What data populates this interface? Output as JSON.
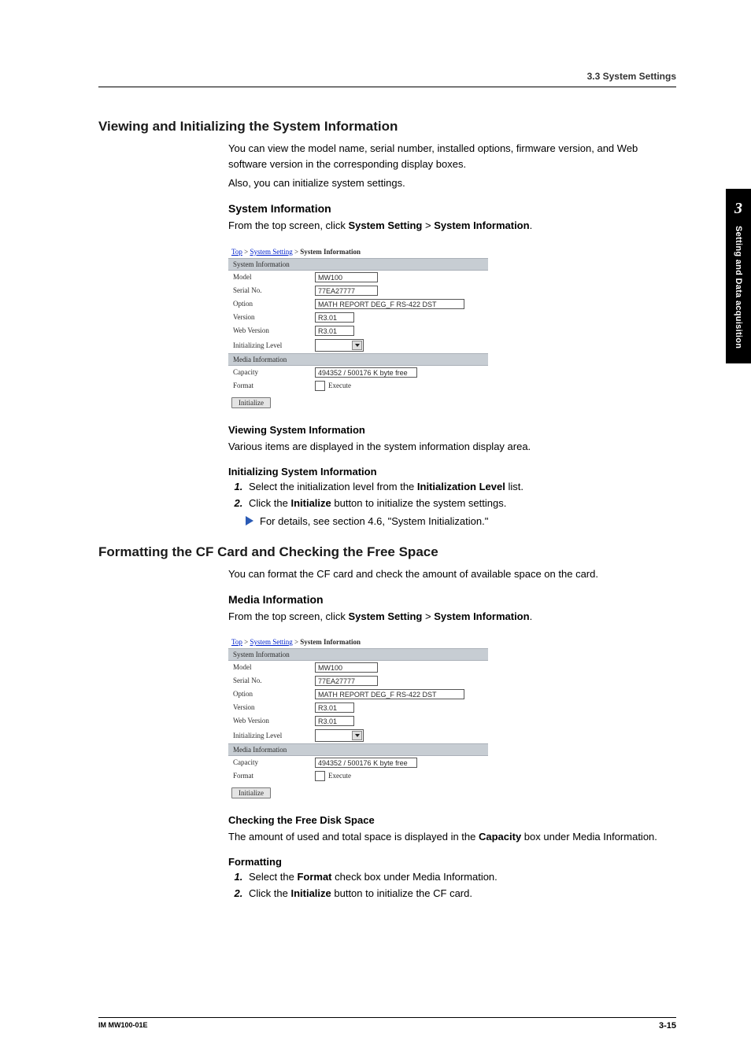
{
  "header": {
    "section": "3.3  System Settings"
  },
  "sideTab": {
    "chapter": "3",
    "label": "Setting and Data acquisition"
  },
  "footer": {
    "doc": "IM MW100-01E",
    "page": "3-15"
  },
  "sec1": {
    "title": "Viewing and Initializing the System Information",
    "intro1": "You can view the model name, serial number, installed options, firmware version, and Web software version in the corresponding display boxes.",
    "intro2": "Also, you can initialize system settings.",
    "h_sysinfo": "System Information",
    "p_path_pre": "From the top screen, click ",
    "p_path_b1": "System Setting",
    "p_path_gt": " > ",
    "p_path_b2": "System Information",
    "p_path_post": ".",
    "h_view": "Viewing System Information",
    "p_view": "Various items are displayed in the system information display area.",
    "h_init": "Initializing System Information",
    "step1_a": "Select the initialization level from the ",
    "step1_b": "Initialization Level",
    "step1_c": " list.",
    "step2_a": "Click the ",
    "step2_b": "Initialize",
    "step2_c": " button to initialize the system settings.",
    "note": "For details, see section 4.6, \"System Initialization.\""
  },
  "sec2": {
    "title": "Formatting the CF Card and Checking the Free Space",
    "intro": "You can format the CF card and check the amount of available space on the card.",
    "h_media": "Media Information",
    "p_path_pre": "From the top screen, click ",
    "p_path_b1": "System Setting",
    "p_path_gt": " > ",
    "p_path_b2": "System Information",
    "p_path_post": ".",
    "h_check": "Checking the Free Disk Space",
    "p_check_a": "The amount of used and total space is displayed in the ",
    "p_check_b": "Capacity",
    "p_check_c": " box under Media Information.",
    "h_fmt": "Formatting",
    "step1_a": "Select the ",
    "step1_b": "Format",
    "step1_c": " check box under Media Information.",
    "step2_a": "Click the ",
    "step2_b": "Initialize",
    "step2_c": " button to initialize the CF card."
  },
  "shot": {
    "crumb_top": "Top",
    "crumb_ss": "System Setting",
    "crumb_si": "System Information",
    "bar_sys": "System Information",
    "bar_media": "Media Information",
    "rows": {
      "model_l": "Model",
      "model_v": "MW100",
      "serial_l": "Serial No.",
      "serial_v": "77EA27777",
      "option_l": "Option",
      "option_v": "MATH REPORT DEG_F RS-422 DST",
      "version_l": "Version",
      "version_v": "R3.01",
      "webver_l": "Web Version",
      "webver_v": "R3.01",
      "initlvl_l": "Initializing Level",
      "capacity_l": "Capacity",
      "capacity_v": "494352 / 500176 K byte free",
      "format_l": "Format",
      "format_v": "Execute"
    },
    "btn": "Initialize"
  }
}
